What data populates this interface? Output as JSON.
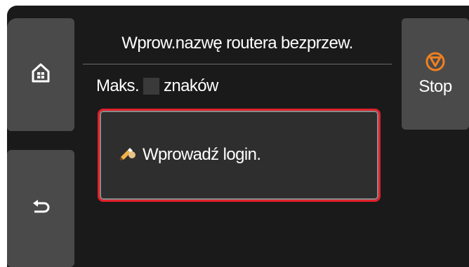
{
  "header": {
    "title": "Wprow.nazwę routera bezprzew."
  },
  "max_chars": {
    "prefix": "Maks.",
    "suffix": "znaków"
  },
  "input": {
    "placeholder": "Wprowadź login."
  },
  "buttons": {
    "home_icon": "home-icon",
    "back_icon": "back-arrow-icon",
    "stop_label": "Stop",
    "stop_icon": "stop-icon"
  },
  "colors": {
    "screen_bg": "#1a1a1a",
    "button_bg": "#4a4a4a",
    "stop_icon": "#f08020",
    "focus_border": "#e3202a"
  }
}
